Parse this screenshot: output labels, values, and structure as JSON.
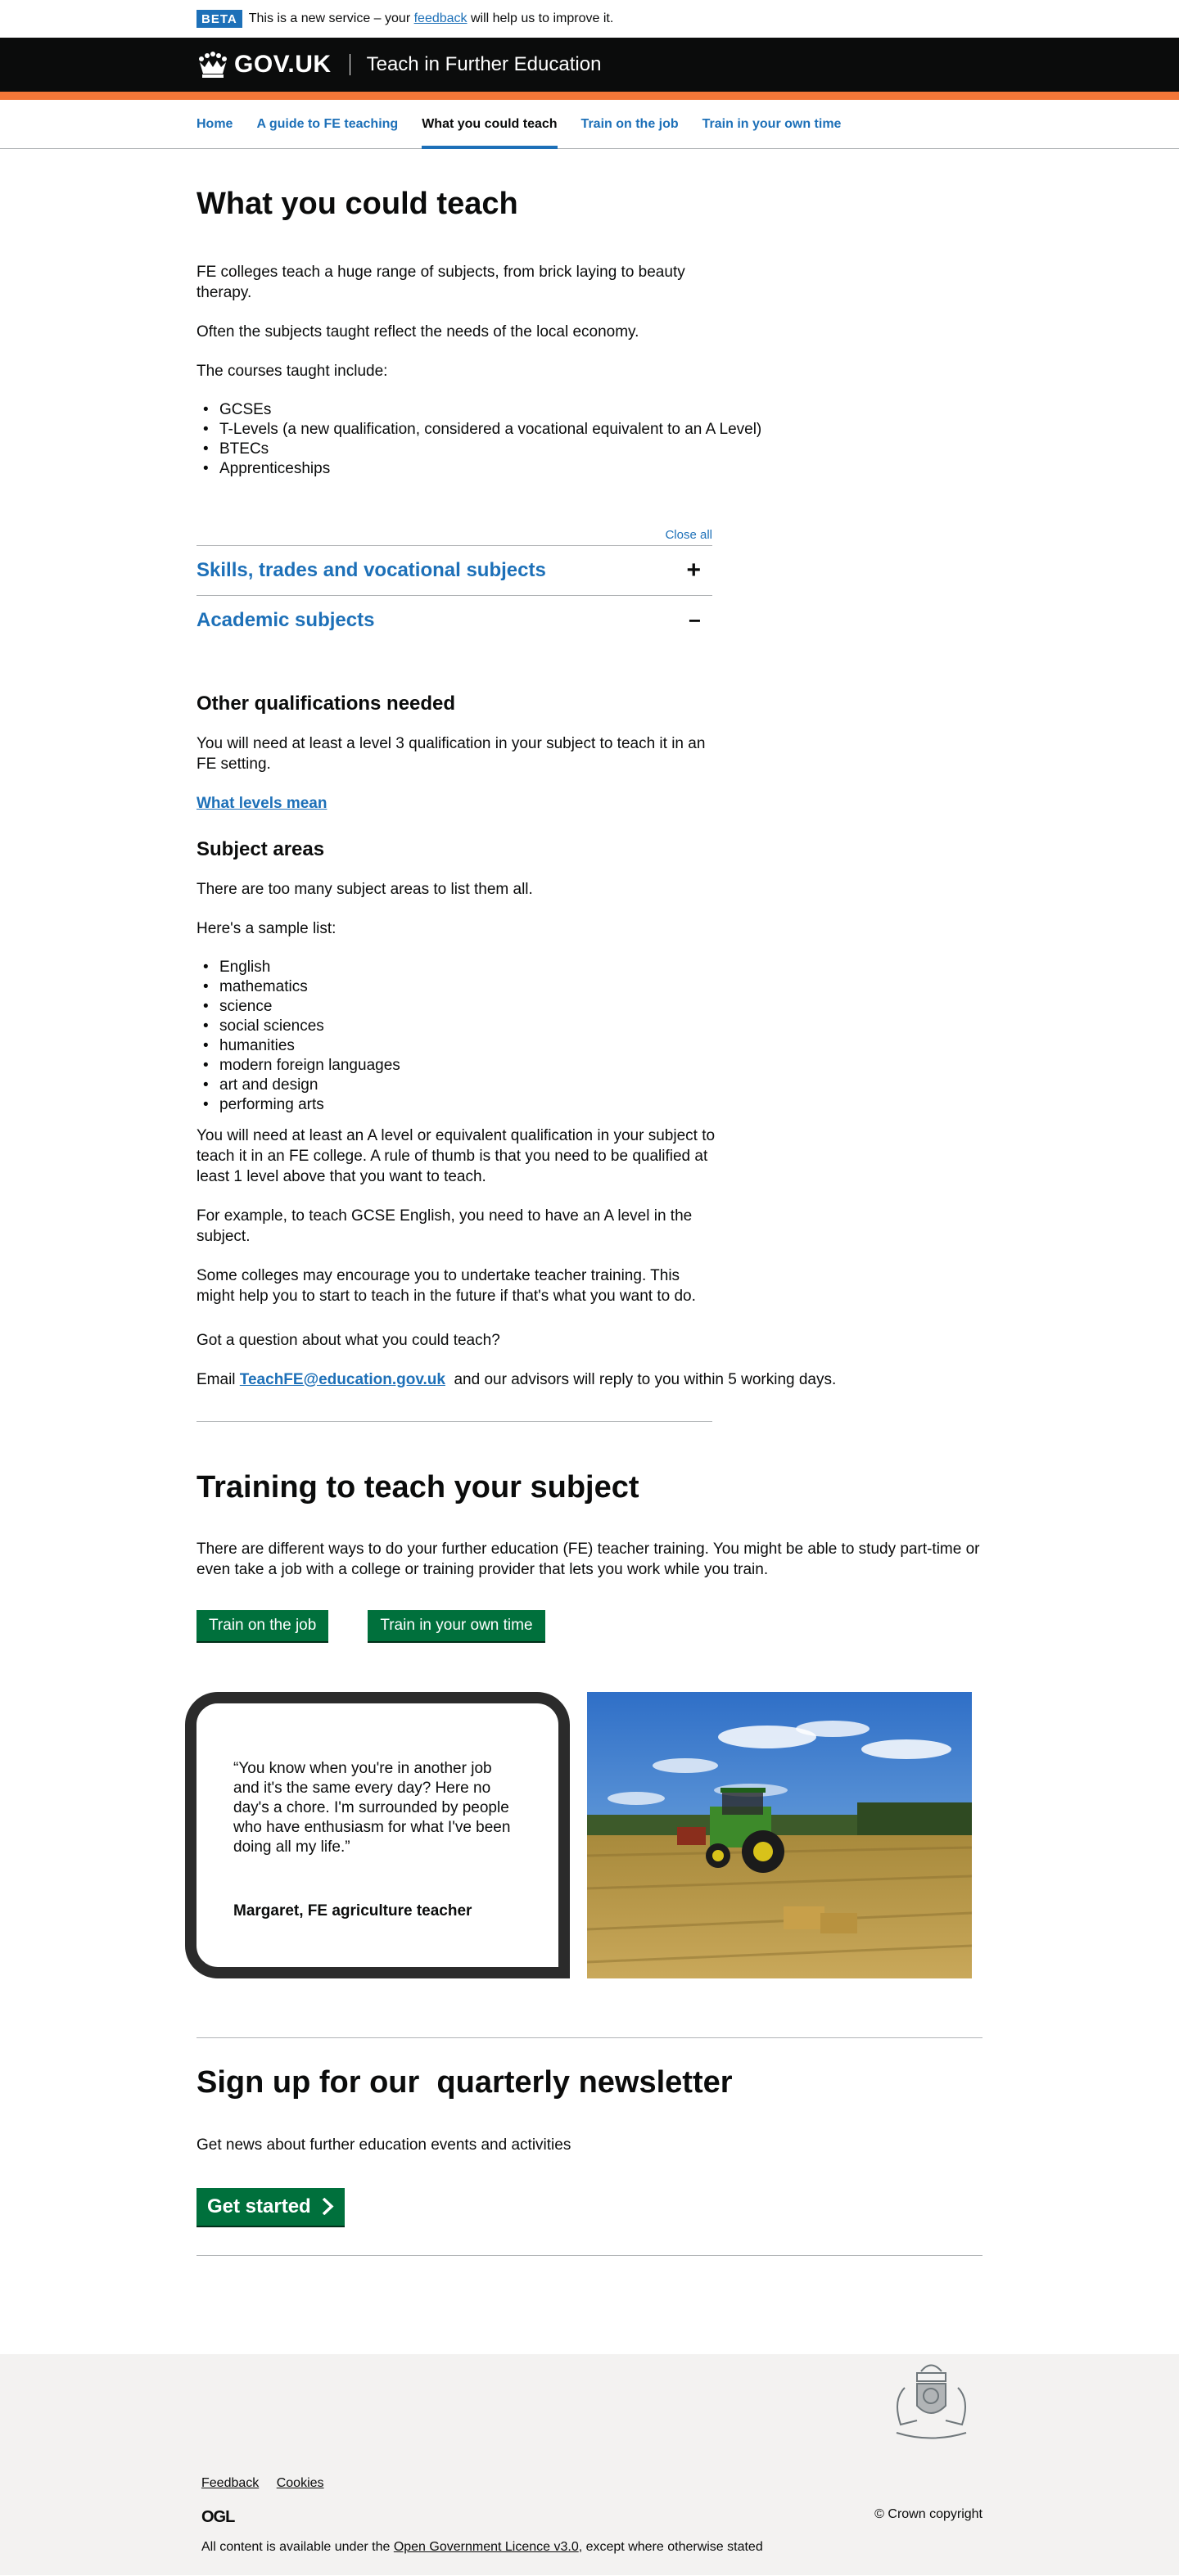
{
  "phase_banner": {
    "tag": "BETA",
    "text_before": "This is a new service – your ",
    "link": "feedback",
    "text_after": " will help us to improve it."
  },
  "header": {
    "logo": "GOV.UK",
    "service_name": "Teach in Further Education"
  },
  "nav": {
    "items": [
      {
        "label": "Home"
      },
      {
        "label": "A guide to FE teaching"
      },
      {
        "label": "What you could teach",
        "active": true
      },
      {
        "label": "Train on the job"
      },
      {
        "label": "Train in your own time"
      }
    ]
  },
  "main": {
    "title": "What you could teach",
    "intro": [
      "FE colleges teach a huge range of subjects, from brick laying to beauty therapy.",
      "Often the subjects taught reflect the needs of the local economy.",
      "The courses taught include:"
    ],
    "courses": [
      "GCSEs",
      "T-Levels (a new qualification, considered a vocational equivalent to an A Level)",
      "BTECs",
      "Apprenticeships"
    ],
    "accordion": {
      "toggle_all": "Close all",
      "sections": [
        {
          "title": "Skills, trades and vocational subjects",
          "icon": "+"
        },
        {
          "title": "Academic subjects",
          "icon": "−"
        }
      ]
    },
    "other_qualifications": {
      "heading": "Other qualifications needed",
      "text": "You will need at least a level 3 qualification in your subject to teach it in an FE setting.",
      "link": "What levels mean"
    },
    "subject_areas": {
      "heading": "Subject areas",
      "p1": "There are too many subject areas to list them all.",
      "p2": "Here's a sample list:",
      "list": [
        "English",
        "mathematics",
        "science",
        "social sciences",
        "humanities",
        "modern foreign languages",
        "art and design",
        "performing arts"
      ],
      "p3": "You will need at least an A level or equivalent qualification in your subject to teach it in an FE college. A rule of thumb is that you need to be qualified at least 1 level above that you want to teach.",
      "p4": "For example, to teach GCSE English, you need to have an A level in the subject.",
      "p5": "Some colleges may encourage you to undertake teacher training. This might help you to start to teach in the future if that's what you want to do."
    },
    "question": {
      "text": "Got a question about what you could teach?",
      "email_prefix": "Email ",
      "email": "TeachFE@education.gov.uk",
      "email_suffix": "  and our advisors will reply to you within 5 working days."
    },
    "training": {
      "title": "Training to teach your subject",
      "text": "There are different ways to do your further education (FE) teacher training. You might be able to study part-time or even take a job with a college or training provider that lets you work while you train.",
      "button1": "Train on the job",
      "button2": "Train in your own time"
    },
    "testimonial": {
      "quote": "“You know when you're in another job and it's the same every day? Here no day's a chore. I'm surrounded by people who have enthusiasm for what I've been doing all my life.”",
      "author": "Margaret, FE agriculture teacher"
    },
    "newsletter": {
      "title": "Sign up for our  quarterly newsletter",
      "text": "Get news about further education events and activities",
      "button": "Get started"
    }
  },
  "footer": {
    "links": [
      "Feedback",
      "Cookies"
    ],
    "ogl": "OGL",
    "licence_prefix": "All content is available under the ",
    "licence_link": "Open Government Licence v3.0",
    "licence_suffix": ", except where otherwise stated",
    "copyright": "© Crown copyright"
  },
  "colors": {
    "brand_blue": "#1d70b8",
    "header_black": "#0b0c0c",
    "header_stripe": "#f47738",
    "button_green": "#00703c",
    "footer_bg": "#f3f2f1"
  }
}
